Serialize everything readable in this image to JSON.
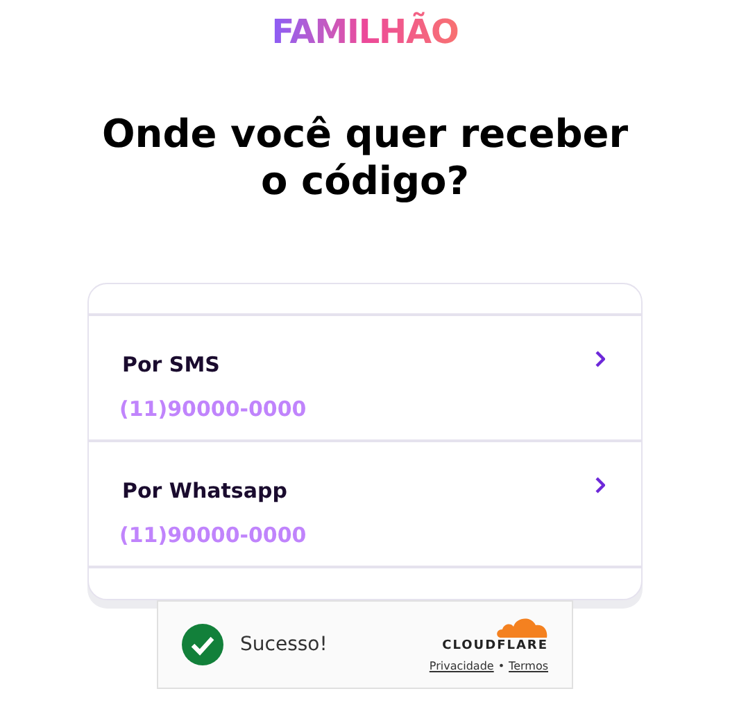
{
  "logo": "FAMILHÃO",
  "heading": "Onde você quer receber o código?",
  "options": [
    {
      "label": "Por SMS",
      "phone": "(11)90000-0000"
    },
    {
      "label": "Por Whatsapp",
      "phone": "(11)90000-0000"
    }
  ],
  "captcha": {
    "status": "Sucesso!",
    "brand": "CLOUDFLARE",
    "links": [
      "Privacidade",
      "Termos"
    ],
    "separator": "•"
  }
}
